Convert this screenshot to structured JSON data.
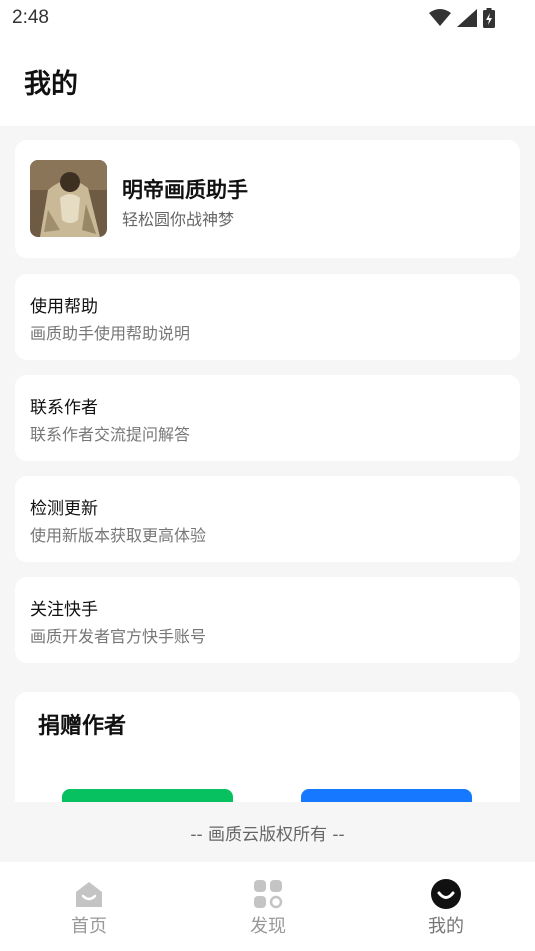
{
  "status_bar": {
    "time": "2:48"
  },
  "header": {
    "title": "我的"
  },
  "profile": {
    "name": "明帝画质助手",
    "subtitle": "轻松圆你战神梦"
  },
  "menu": [
    {
      "title": "使用帮助",
      "subtitle": "画质助手使用帮助说明"
    },
    {
      "title": "联系作者",
      "subtitle": "联系作者交流提问解答"
    },
    {
      "title": "检测更新",
      "subtitle": "使用新版本获取更高体验"
    },
    {
      "title": "关注快手",
      "subtitle": "画质开发者官方快手账号"
    }
  ],
  "donate": {
    "title": "捐赠作者",
    "colors": {
      "wechat": "#07c160",
      "alipay": "#1677ff"
    }
  },
  "footer": {
    "copyright": "-- 画质云版权所有 --"
  },
  "tabs": [
    {
      "label": "首页",
      "icon": "home-icon"
    },
    {
      "label": "发现",
      "icon": "discover-grid-icon"
    },
    {
      "label": "我的",
      "icon": "smile-face-icon",
      "active": true
    }
  ]
}
